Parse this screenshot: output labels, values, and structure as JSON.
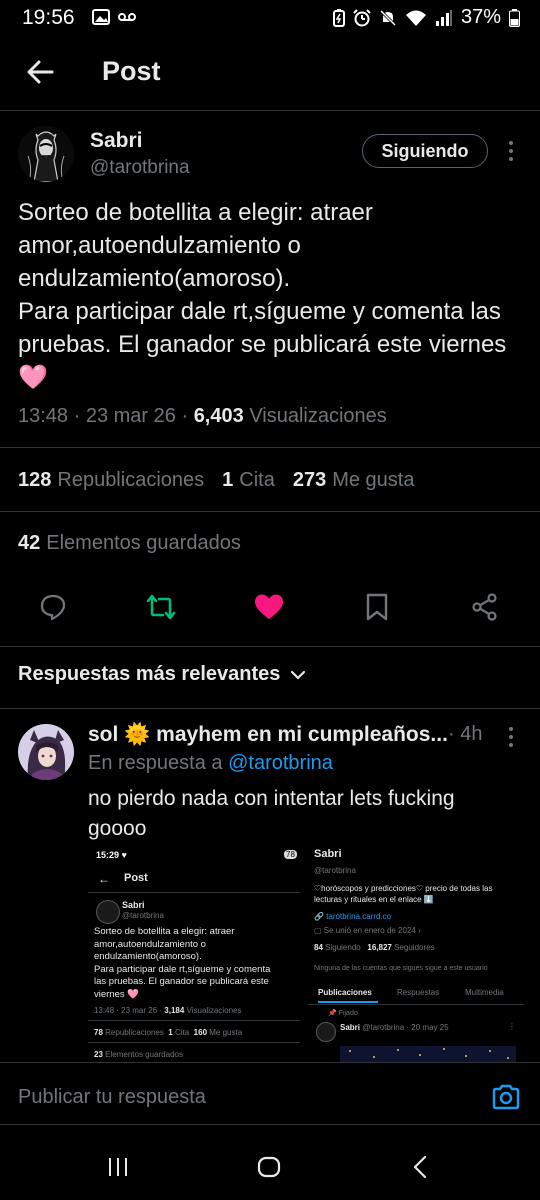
{
  "status_bar": {
    "time": "19:56",
    "battery": "37%"
  },
  "header": {
    "title": "Post"
  },
  "post": {
    "author_name": "Sabri",
    "author_handle": "@tarotbrina",
    "follow_label": "Siguiendo",
    "text": "Sorteo de botellita a elegir: atraer amor,autoendulzamiento o endulzamiento(amoroso).\nPara participar dale rt,sígueme y comenta las pruebas. El ganador se publicará este viernes 🩷",
    "time": "13:48",
    "date": "23 mar 26",
    "views_count": "6,403",
    "views_label": "Visualizaciones",
    "reposts_count": "128",
    "reposts_label": "Republicaciones",
    "quotes_count": "1",
    "quotes_label": "Cita",
    "likes_count": "273",
    "likes_label": "Me gusta",
    "saved_count": "42",
    "saved_label": "Elementos guardados"
  },
  "replies_sort": {
    "label": "Respuestas más relevantes"
  },
  "reply": {
    "name": "sol 🌞 mayhem en mi cumpleaños...",
    "time": "· 4h",
    "in_reply_prefix": "En respuesta a",
    "in_reply_handle": "@tarotbrina",
    "text": "no pierdo nada con intentar lets fucking goooo"
  },
  "embedded_screenshot": {
    "left": {
      "time": "15:29 ♥",
      "battery": "78",
      "title": "Post",
      "author_name": "Sabri",
      "author_handle": "@tarotbrina",
      "text_lines": [
        "Sorteo de botellita a elegir: atraer",
        "amor,autoendulzamiento o",
        "endulzamiento(amoroso).",
        "Para participar dale rt,sígueme y comenta",
        "las pruebas. El ganador se publicará este",
        "viernes 🩷"
      ],
      "meta_prefix": "13:48 · 23 mar 26 ·",
      "views_count": "3,184",
      "views_label": "Visualizaciones",
      "reposts_count": "78",
      "reposts_label": "Republicaciones",
      "quotes_count": "1",
      "quotes_label": "Cita",
      "likes_count": "160",
      "likes_label": "Me gusta",
      "saved_count": "23",
      "saved_label": "Elementos guardados"
    },
    "right": {
      "name": "Sabri",
      "handle": "@tarotbrina",
      "bio_line1": "♡horóscopos y predicciones♡ precio de todas las",
      "bio_line2": "lecturas y rituales en el enlace ⬇️",
      "link": "tarotbrina.carrd.co",
      "joined": "Se unió en enero de 2024",
      "following_count": "84",
      "following_label": "Siguiendo",
      "followers_count": "16,827",
      "followers_label": "Seguidores",
      "no_common": "Ninguna de las cuentas que sigues sigue a este usuario",
      "tabs": [
        "Publicaciones",
        "Respuestas",
        "Multimedia"
      ],
      "pinned_label": "Fijado",
      "pinned_author": "Sabri",
      "pinned_meta": "@tarotbrina · 20 may 25"
    }
  },
  "compose": {
    "placeholder": "Publicar tu respuesta"
  },
  "colors": {
    "background": "#000000",
    "text": "#e7e9ea",
    "muted": "#71767b",
    "accent": "#1d9bf0",
    "repost_green": "#00ba7c",
    "like_pink": "#f91880",
    "divider": "#2f3336"
  },
  "icons": [
    "back-arrow-icon",
    "more-icon",
    "reply-icon",
    "repost-icon",
    "like-icon",
    "bookmark-icon",
    "share-icon",
    "chevron-down-icon",
    "camera-icon",
    "recents-icon",
    "home-icon",
    "back-nav-icon"
  ]
}
